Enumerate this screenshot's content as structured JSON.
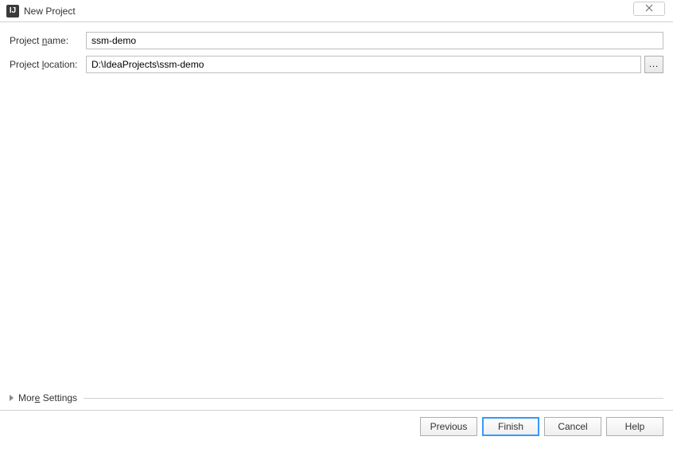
{
  "titlebar": {
    "title": "New Project"
  },
  "form": {
    "project_name_label_prefix": "Project ",
    "project_name_label_u": "n",
    "project_name_label_suffix": "ame:",
    "project_name_value": "ssm-demo",
    "project_location_label_prefix": "Project ",
    "project_location_label_u": "l",
    "project_location_label_suffix": "ocation:",
    "project_location_value": "D:\\IdeaProjects\\ssm-demo",
    "browse_label": "..."
  },
  "more_settings": {
    "label_prefix": "Mor",
    "label_u": "e",
    "label_suffix": " Settings"
  },
  "buttons": {
    "previous": "Previous",
    "finish": "Finish",
    "cancel": "Cancel",
    "help": "Help"
  }
}
